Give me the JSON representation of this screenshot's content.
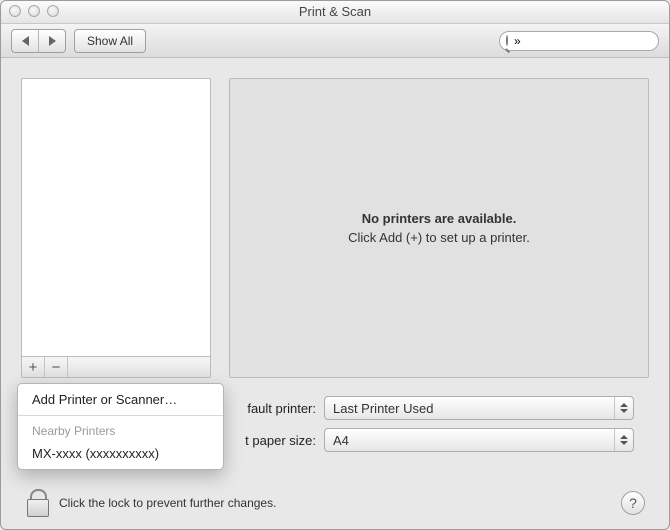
{
  "window": {
    "title": "Print & Scan"
  },
  "toolbar": {
    "show_all_label": "Show All",
    "search_value": "»"
  },
  "sidebar": {
    "add_glyph": "+",
    "remove_glyph": "−"
  },
  "detail": {
    "no_printers_line1": "No printers are available.",
    "no_printers_line2": "Click Add (+) to set up a printer."
  },
  "form": {
    "default_printer_label": "fault printer:",
    "default_printer_value": "Last Printer Used",
    "paper_size_label": "t paper size:",
    "paper_size_value": "A4"
  },
  "lock": {
    "text": "Click the lock to prevent further changes."
  },
  "help": {
    "glyph": "?"
  },
  "context_menu": {
    "add_item": "Add Printer or Scanner…",
    "section_label": "Nearby Printers",
    "nearby_item_1": "MX-xxxx (xxxxxxxxxx)"
  }
}
